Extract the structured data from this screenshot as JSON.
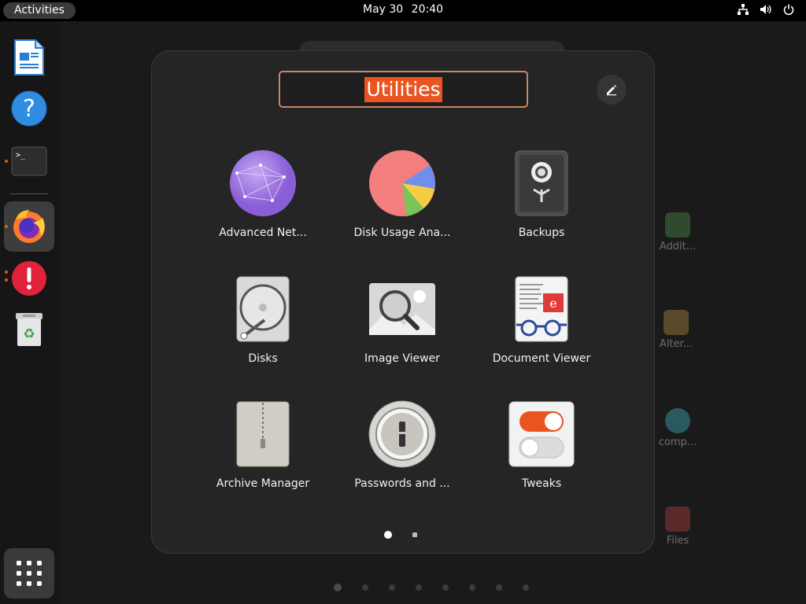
{
  "topbar": {
    "activities_label": "Activities",
    "date": "May 30",
    "time": "20:40"
  },
  "dock": {
    "items": [
      {
        "name": "LibreOffice Writer",
        "icon": "document-writer-icon",
        "running": false
      },
      {
        "name": "Help",
        "icon": "help-icon",
        "running": false
      },
      {
        "name": "Terminal",
        "icon": "terminal-icon",
        "running": true
      },
      {
        "name": "Firefox",
        "icon": "firefox-icon",
        "running": true
      },
      {
        "name": "Ubuntu Software Updater",
        "icon": "warning-icon",
        "running": true
      },
      {
        "name": "Trash",
        "icon": "trash-icon",
        "running": false
      }
    ],
    "show_apps_icon": "grid-icon"
  },
  "background_apps": [
    {
      "label": "Addit..."
    },
    {
      "label": "Alter..."
    },
    {
      "label": "comp..."
    },
    {
      "label": "Files"
    }
  ],
  "folder": {
    "name": "Utilities",
    "apps": [
      {
        "label": "Advanced Net...",
        "icon": "advanced-network-icon"
      },
      {
        "label": "Disk Usage Ana...",
        "icon": "disk-usage-pie-icon"
      },
      {
        "label": "Backups",
        "icon": "backups-safe-icon"
      },
      {
        "label": "Disks",
        "icon": "disks-icon"
      },
      {
        "label": "Image Viewer",
        "icon": "image-viewer-icon"
      },
      {
        "label": "Document Viewer",
        "icon": "document-viewer-icon"
      },
      {
        "label": "Archive Manager",
        "icon": "archive-manager-icon"
      },
      {
        "label": "Passwords and ...",
        "icon": "passwords-keyring-icon"
      },
      {
        "label": "Tweaks",
        "icon": "tweaks-toggle-icon"
      }
    ],
    "page_count": 2,
    "current_page": 1
  },
  "overview_page_count": 8,
  "colors": {
    "accent": "#e95420",
    "folder_bg": "#252525",
    "panel_bg": "#000000"
  }
}
